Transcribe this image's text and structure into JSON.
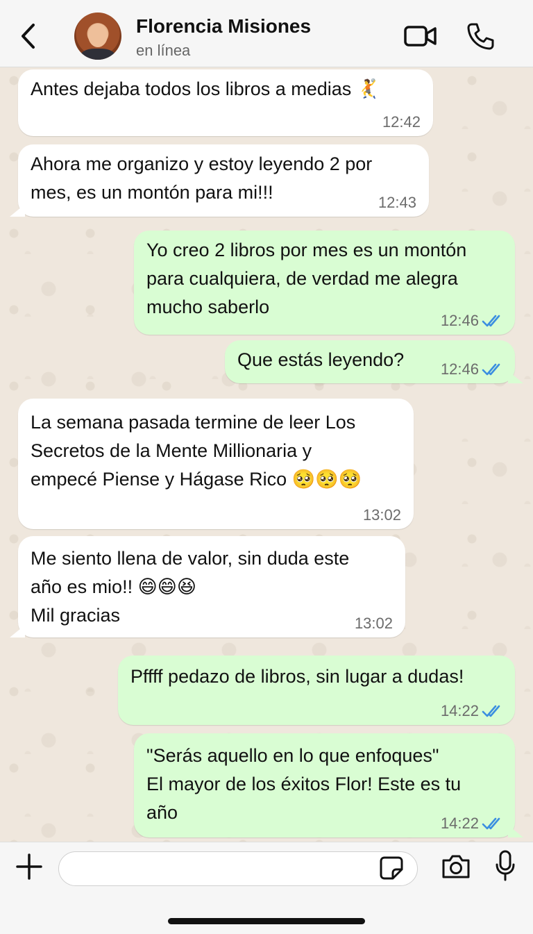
{
  "header": {
    "contact_name": "Florencia Misiones",
    "status": "en línea",
    "icons": [
      "chevron-left-icon",
      "video-camera-icon",
      "phone-icon"
    ]
  },
  "colors": {
    "incoming_bubble": "#ffffff",
    "outgoing_bubble": "#d9fdd3",
    "read_ticks": "#3b8ee0",
    "chat_background": "#efe7dd"
  },
  "messages": [
    {
      "direction": "in",
      "text": "Antes dejaba todos los libros a medias 🤾",
      "time": "12:42"
    },
    {
      "direction": "in",
      "text": "Ahora me organizo y estoy leyendo 2 por\nmes, es un montón para mi!!!",
      "time": "12:43"
    },
    {
      "direction": "out",
      "text": "Yo creo 2 libros por mes es un montón\npara cualquiera, de verdad me alegra\nmucho saberlo",
      "time": "12:46",
      "status": "read"
    },
    {
      "direction": "out",
      "text": "Que estás leyendo?",
      "time": "12:46",
      "status": "read"
    },
    {
      "direction": "in",
      "text": "La semana pasada termine de leer Los\nSecretos de la Mente Millionaria y\nempecé Piense y Hágase Rico 🥺🥺🥺",
      "time": "13:02"
    },
    {
      "direction": "in",
      "text": "Me siento llena de valor, sin duda este\naño es mio!! 😄😄😆\nMil gracias",
      "time": "13:02"
    },
    {
      "direction": "out",
      "text": "Pffff pedazo de libros, sin lugar a dudas!",
      "time": "14:22",
      "status": "read"
    },
    {
      "direction": "out",
      "text": "\"Serás aquello en lo que enfoques\"\nEl mayor de los éxitos Flor! Este es tu\naño",
      "time": "14:22",
      "status": "read"
    }
  ],
  "input": {
    "value": "",
    "icons": [
      "plus-icon",
      "sticker-icon",
      "camera-icon",
      "microphone-icon"
    ]
  }
}
